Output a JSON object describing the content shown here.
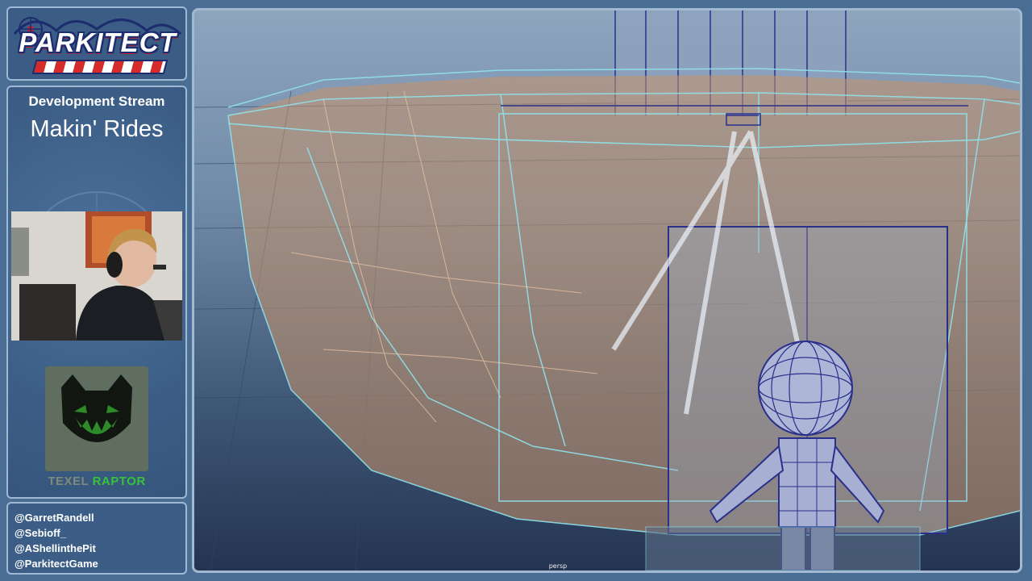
{
  "branding": {
    "logo_text": "PARKITECT"
  },
  "stream": {
    "title": "Development Stream",
    "subtitle": "Makin' Rides"
  },
  "sponsor": {
    "name_part1": "TEXEL",
    "name_part2": "RAPTOR"
  },
  "social": {
    "handles": [
      "@GarretRandell",
      "@Sebioff_",
      "@AShellinthePit",
      "@ParkitectGame"
    ]
  },
  "viewport": {
    "camera_label": "persp"
  },
  "colors": {
    "background": "#4a6d94",
    "panel_border": "#9fb8d4",
    "texel_green": "#38c23a",
    "wireframe_cyan": "#8fe3ec",
    "wireframe_blue": "#2a2f8a",
    "mesh_orange": "#c8936a"
  },
  "icons": {
    "logo": "parkitect-rollercoaster-logo",
    "sponsor": "texel-raptor-face-logo"
  }
}
